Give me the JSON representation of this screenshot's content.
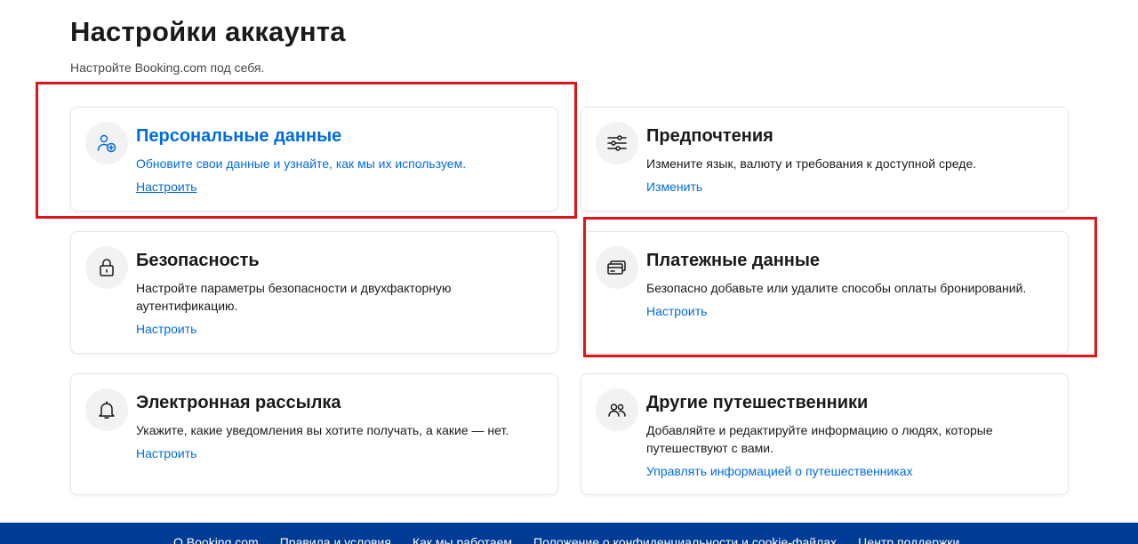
{
  "header": {
    "title": "Настройки аккаунта",
    "subtitle": "Настройте Booking.com под себя."
  },
  "cards": {
    "personal": {
      "icon": "user-add-icon",
      "title": "Персональные данные",
      "description": "Обновите свои данные и узнайте, как мы их используем.",
      "link": "Настроить"
    },
    "preferences": {
      "icon": "sliders-icon",
      "title": "Предпочтения",
      "description": "Измените язык, валюту и требования к доступной среде.",
      "link": "Изменить"
    },
    "security": {
      "icon": "lock-icon",
      "title": "Безопасность",
      "description": "Настройте параметры безопасности и двухфакторную аутентификацию.",
      "link": "Настроить"
    },
    "payment": {
      "icon": "credit-cards-icon",
      "title": "Платежные данные",
      "description": "Безопасно добавьте или удалите способы оплаты бронирований.",
      "link": "Настроить"
    },
    "email": {
      "icon": "bell-icon",
      "title": "Электронная рассылка",
      "description": "Укажите, какие уведомления вы хотите получать, а какие — нет.",
      "link": "Настроить"
    },
    "travelers": {
      "icon": "people-icon",
      "title": "Другие путешественники",
      "description": "Добавляйте и редактируйте информацию о людях, которые путешествуют с вами.",
      "link": "Управлять информацией о путешественниках"
    }
  },
  "footer": {
    "links": [
      "О Booking.com",
      "Правила и условия",
      "Как мы работаем",
      "Положение о конфиденциальности и cookie-файлах",
      "Центр поддержки"
    ]
  },
  "colors": {
    "accent": "#006ce4",
    "highlight": "#e0141b",
    "footer": "#003b95"
  }
}
